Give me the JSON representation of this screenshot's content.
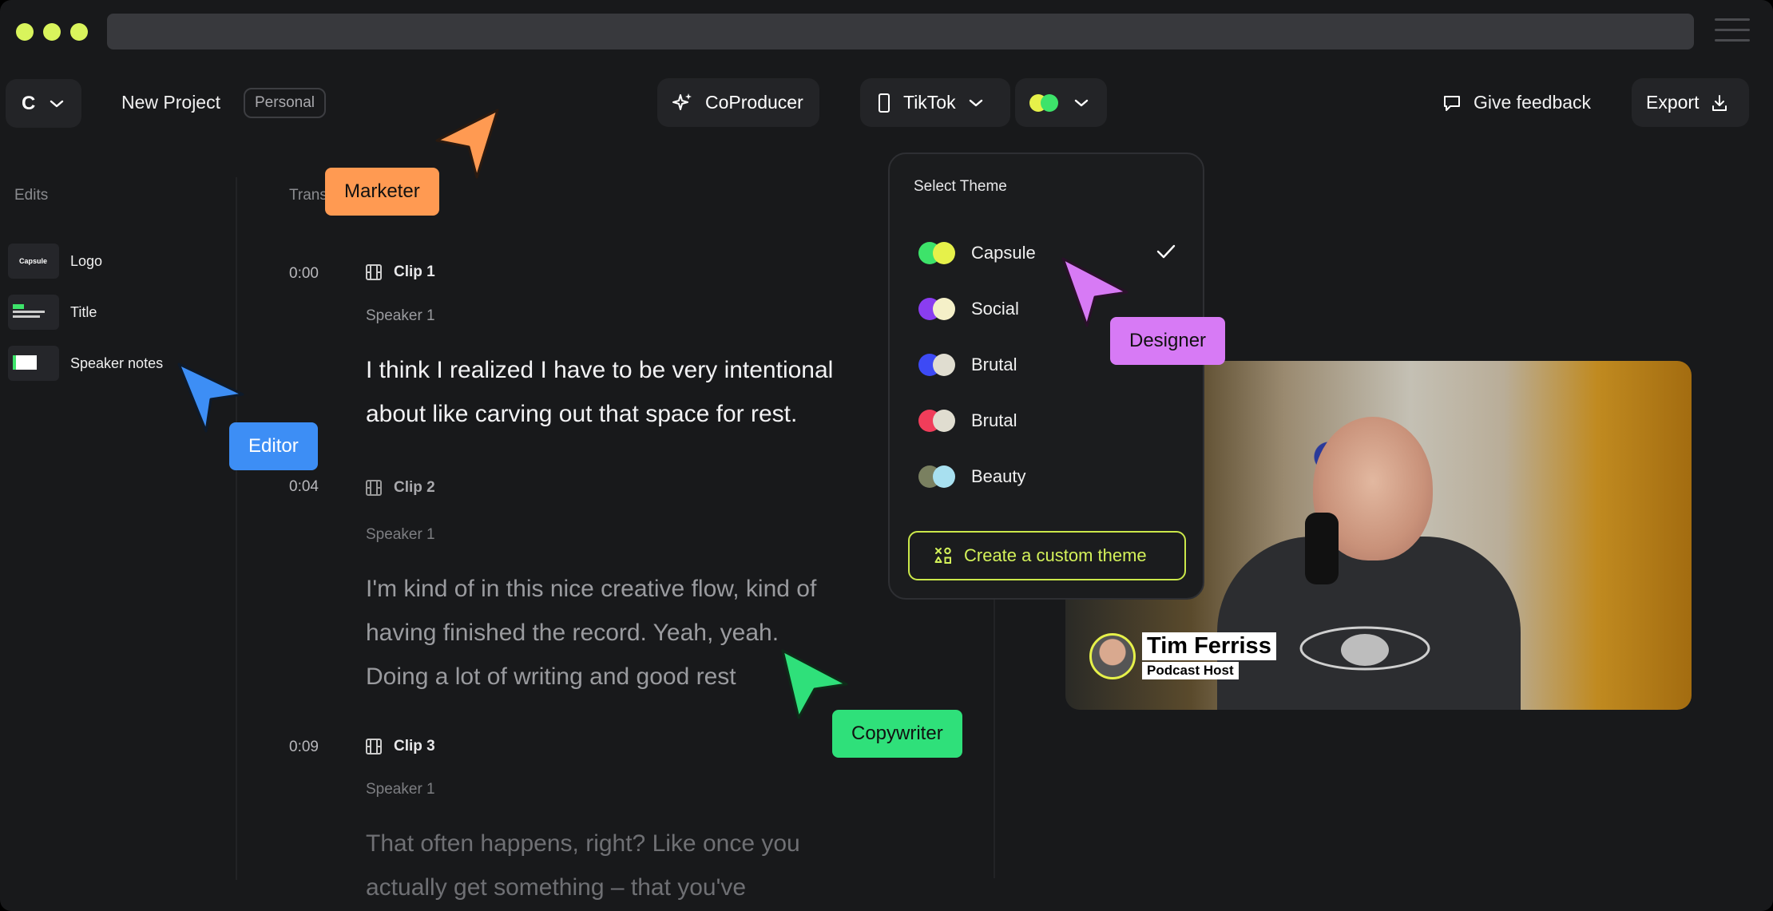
{
  "window": {
    "accent": "#d9f45c"
  },
  "header": {
    "project_initial": "C",
    "project_name": "New Project",
    "workspace_tag": "Personal",
    "coproducer_label": "CoProducer",
    "format_label": "TikTok",
    "feedback_label": "Give feedback",
    "export_label": "Export"
  },
  "sidebar": {
    "heading": "Edits",
    "items": [
      {
        "label": "Logo",
        "thumb_text": "Capsule"
      },
      {
        "label": "Title"
      },
      {
        "label": "Speaker notes"
      }
    ]
  },
  "transcript": {
    "heading": "Trans",
    "clips": [
      {
        "time": "0:00",
        "title": "Clip 1",
        "speaker": "Speaker 1",
        "lines": [
          "I think I realized I have to be very intentional",
          "about like carving out that space for rest."
        ]
      },
      {
        "time": "0:04",
        "title": "Clip 2",
        "speaker": "Speaker 1",
        "lines": [
          "I'm kind of in this nice creative flow, kind of",
          "having finished the record. Yeah, yeah.",
          "Doing a lot of writing and good rest"
        ]
      },
      {
        "time": "0:09",
        "title": "Clip 3",
        "speaker": "Speaker 1",
        "lines": [
          "That often happens, right? Like once you",
          "actually get something – that you've"
        ]
      }
    ]
  },
  "theme_menu": {
    "title": "Select Theme",
    "options": [
      {
        "label": "Capsule",
        "color_a": "#3de36a",
        "color_b": "#e6f14a",
        "selected": true
      },
      {
        "label": "Social",
        "color_a": "#8a3df0",
        "color_b": "#f5f0c8",
        "selected": false
      },
      {
        "label": "Brutal",
        "color_a": "#3d4af5",
        "color_b": "#e0ddd0",
        "selected": false
      },
      {
        "label": "Brutal",
        "color_a": "#f03d5a",
        "color_b": "#e0ddd0",
        "selected": false
      },
      {
        "label": "Beauty",
        "color_a": "#7a8060",
        "color_b": "#a8e0f0",
        "selected": false
      }
    ],
    "create_label": "Create a custom theme"
  },
  "video": {
    "lower_third_name": "Tim Ferriss",
    "lower_third_role": "Podcast Host"
  },
  "collaborators": [
    {
      "label": "Marketer",
      "color": "#ff9a52"
    },
    {
      "label": "Editor",
      "color": "#3d8ef5"
    },
    {
      "label": "Designer",
      "color": "#d77af5"
    },
    {
      "label": "Copywriter",
      "color": "#2fe07a"
    }
  ]
}
